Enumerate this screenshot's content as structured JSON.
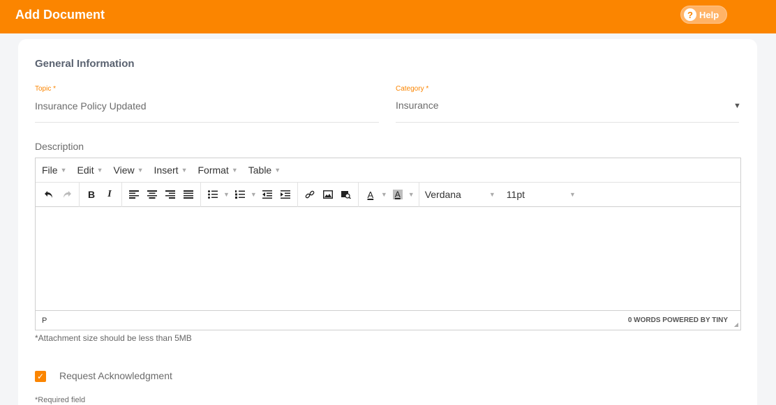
{
  "header": {
    "title": "Add Document",
    "help_label": "Help",
    "accent_color": "#fb8500"
  },
  "form": {
    "section_title": "General Information",
    "topic": {
      "label": "Topic *",
      "value": "Insurance Policy Updated"
    },
    "category": {
      "label": "Category *",
      "value": "Insurance"
    },
    "description_label": "Description"
  },
  "editor": {
    "menu": [
      "File",
      "Edit",
      "View",
      "Insert",
      "Format",
      "Table"
    ],
    "font_family": "Verdana",
    "font_size": "11pt",
    "status_path": "P",
    "status_words": "0 WORDS POWERED BY TINY",
    "icons": [
      "undo-icon",
      "redo-icon",
      "bold-icon",
      "italic-icon",
      "align-left-icon",
      "align-center-icon",
      "align-right-icon",
      "align-justify-icon",
      "bullet-list-icon",
      "numbered-list-icon",
      "outdent-icon",
      "indent-icon",
      "link-icon",
      "image-icon",
      "media-icon",
      "text-color-icon",
      "background-color-icon"
    ]
  },
  "attachment_note": "*Attachment size should be less than 5MB",
  "acknowledgment": {
    "label": "Request Acknowledgment",
    "checked": true
  },
  "required_note": "*Required field"
}
